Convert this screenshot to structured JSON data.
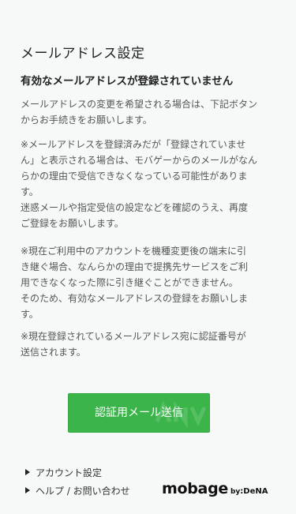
{
  "page": {
    "title": "メールアドレス設定",
    "headline": "有効なメールアドレスが登録されていません"
  },
  "paragraphs": {
    "p1": [
      "メールアドレスの変更を希望される場合は、下記ボタン",
      "からお手続きをお願いします。"
    ],
    "p2": [
      "※メールアドレスを登録済みだが「登録されていませ",
      "ん」と表示される場合は、モバゲーからのメールがなん",
      "らかの理由で受信できなくなっている可能性がありま",
      "す。",
      "迷惑メールや指定受信の設定などを確認のうえ、再度",
      "ご登録をお願いします。"
    ],
    "p3": [
      "※現在ご利用中のアカウントを機種変更後の端末に引",
      "き継ぐ場合、なんらかの理由で提携先サービスをご利",
      "用できなくなった際に引き継ぐことができません。",
      "そのため、有効なメールアドレスの登録をお願いしま",
      "す。"
    ],
    "p4": [
      "※現在登録されているメールアドレス宛に認証番号が",
      "送信されます。"
    ]
  },
  "button": {
    "label": "認証用メール送信",
    "color": "#3bb54a"
  },
  "footer": {
    "links": [
      {
        "label": "アカウント設定",
        "icon": "triangle-right-icon"
      },
      {
        "label": "ヘルプ / お問い合わせ",
        "icon": "triangle-right-icon"
      }
    ],
    "logo": {
      "main": "mobage",
      "by": "by",
      "company": ":DeNA"
    }
  },
  "colors": {
    "background": "#f7f9f9",
    "text": "#333333",
    "accent": "#3bb54a"
  }
}
